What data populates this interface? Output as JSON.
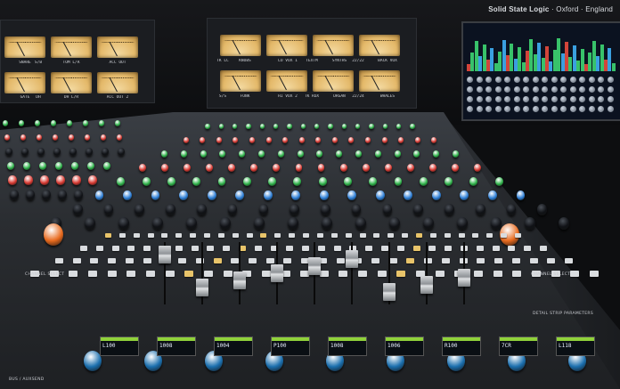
{
  "brand": {
    "name": "Solid State Logic",
    "sep1": "·",
    "city": "Oxford",
    "sep2": "·",
    "country": "England"
  },
  "meter_bridge_left": {
    "labels": [
      "SNARE",
      "S/B",
      "TOM L/R",
      "",
      "ACC OUT",
      "GATE",
      "DH",
      "DH L/R",
      "",
      "ACC OUT 2"
    ]
  },
  "meter_bridge_center": {
    "labels": [
      "TK LC",
      "KNOBS",
      "LO VOX 1",
      "TEXTM",
      "SYNTHS",
      "SYNTH 2",
      "22/22",
      "BACK VOX",
      "S/S",
      "FUNK",
      "HI VOX 2",
      "TK ROX",
      "DRGAN",
      "STRINGS",
      "22/24",
      "WHALES"
    ]
  },
  "lcd_strip": {
    "values": [
      "L100",
      "1008",
      "1004",
      "P100",
      "1008",
      "1006",
      "R100",
      "7CR",
      "L118"
    ]
  },
  "panel_labels": {
    "left_lower": "CHANNEL SELECT",
    "left_bottom": "BUS / AUXSEND",
    "right_lower": "CHANNEL SELECT",
    "right_bottom": "DETAIL STRIP PARAMETERS"
  },
  "colors": {
    "console_top": "#3a3e44",
    "vu_face": "#e4b96a",
    "knob_green": "#2fb24a",
    "knob_red": "#d83a32",
    "knob_blue": "#2e7fd6",
    "knob_orange": "#e86a1e",
    "lcd_header": "#8fd13a"
  }
}
